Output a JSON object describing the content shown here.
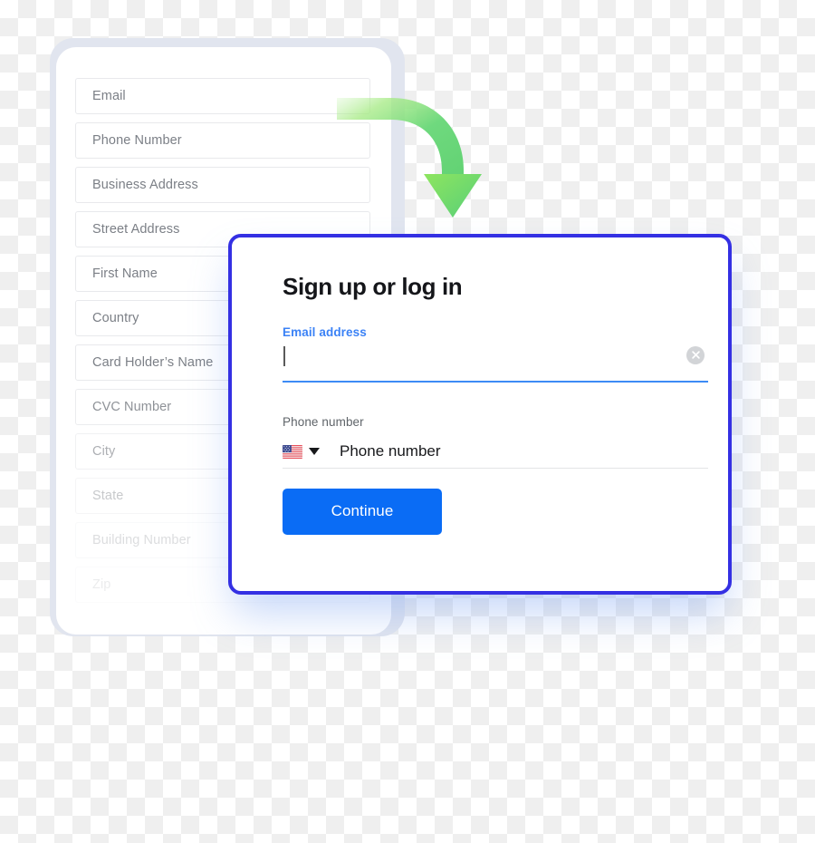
{
  "background": {
    "type": "transparency-checkerboard",
    "colors": [
      "#ffffff",
      "#efefef"
    ],
    "square_size_px": 20
  },
  "long_form": {
    "name": "long-signup-form",
    "fields": [
      {
        "placeholder": "Email"
      },
      {
        "placeholder": "Phone Number"
      },
      {
        "placeholder": "Business Address"
      },
      {
        "placeholder": "Street Address"
      },
      {
        "placeholder": "First Name"
      },
      {
        "placeholder": "Country"
      },
      {
        "placeholder": "Card Holder’s Name"
      },
      {
        "placeholder": "CVC Number"
      },
      {
        "placeholder": "City"
      },
      {
        "placeholder": "State"
      },
      {
        "placeholder": "Building Number"
      },
      {
        "placeholder": "Zip"
      }
    ]
  },
  "arrow": {
    "name": "green-curved-arrow",
    "direction": "down-right",
    "color_start": "#9ce86a",
    "color_end": "#3fc878"
  },
  "signup_card": {
    "title": "Sign up or log in",
    "border_color": "#3430e3",
    "email": {
      "label": "Email address",
      "label_color": "#3b82f6",
      "value": "",
      "placeholder": "",
      "underline_color": "#3d8bf5",
      "clear_icon": "close-circle-icon"
    },
    "phone": {
      "label": "Phone number",
      "country_flag": "us-flag-icon",
      "country_code_dropdown": "chevron-down-icon",
      "value": "",
      "placeholder": "Phone number"
    },
    "continue_label": "Continue",
    "continue_color": "#0a6cf5"
  }
}
